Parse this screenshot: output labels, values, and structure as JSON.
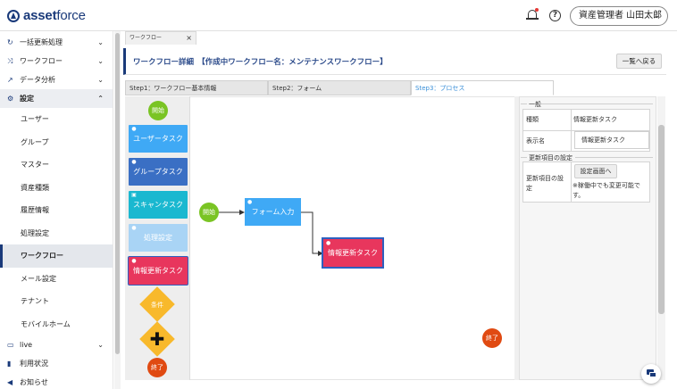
{
  "app": {
    "logo_text_bold": "asset",
    "logo_text_light": "force"
  },
  "header": {
    "user_label": "資産管理者 山田太郎",
    "icons": [
      "bell-icon",
      "help-icon"
    ]
  },
  "sidebar": {
    "items": [
      {
        "label": "一括更新処理",
        "icon": "refresh-icon",
        "chevron": "down"
      },
      {
        "label": "ワークフロー",
        "icon": "workflow-icon",
        "chevron": "down"
      },
      {
        "label": "データ分析",
        "icon": "chart-icon",
        "chevron": "down"
      },
      {
        "label": "設定",
        "icon": "gear-icon",
        "chevron": "up"
      }
    ],
    "sub_items": [
      {
        "label": "ユーザー"
      },
      {
        "label": "グループ"
      },
      {
        "label": "マスター"
      },
      {
        "label": "資産種類"
      },
      {
        "label": "履歴情報"
      },
      {
        "label": "処理設定"
      },
      {
        "label": "ワークフロー",
        "active": true
      },
      {
        "label": "メール設定"
      },
      {
        "label": "テナント"
      },
      {
        "label": "モバイルホーム"
      }
    ],
    "bottom_items": [
      {
        "label": "live",
        "icon": "live-icon",
        "chevron": "down"
      },
      {
        "label": "利用状況",
        "icon": "bar-chart-icon"
      },
      {
        "label": "お知らせ",
        "icon": "megaphone-icon"
      }
    ]
  },
  "main": {
    "tab_label": "ワークフロー",
    "title": "ワークフロー詳細　【作成中ワークフロー名：メンテナンスワークフロー】",
    "back_button": "一覧へ戻る",
    "steps": [
      {
        "label": "Step1：ワークフロー基本情報"
      },
      {
        "label": "Step2：フォーム"
      },
      {
        "label": "Step3：プロセス",
        "active": true
      }
    ]
  },
  "palette": {
    "start": "開始",
    "items": [
      {
        "label": "ユーザータスク",
        "color": "#3fa9f5",
        "icon": "user-icon"
      },
      {
        "label": "グループタスク",
        "color": "#3a6fc4",
        "icon": "group-icon"
      },
      {
        "label": "スキャンタスク",
        "color": "#1ab8d0",
        "icon": "scan-icon"
      },
      {
        "label": "処理設定",
        "color": "#a9d4f5",
        "icon": "process-icon"
      },
      {
        "label": "情報更新タスク",
        "color": "#e8365d",
        "icon": "update-icon"
      }
    ],
    "condition": "条件",
    "end": "終了",
    "accent_yellow": "#f8b92c"
  },
  "canvas": {
    "start": "開始",
    "nodes": [
      {
        "label": "フォーム入力",
        "color": "#3fa9f5"
      },
      {
        "label": "情報更新タスク",
        "color": "#e8365d"
      }
    ],
    "end": "終了"
  },
  "properties": {
    "general_section": "一般",
    "rows": [
      {
        "label": "種類",
        "value": "情報更新タスク"
      },
      {
        "label": "表示名",
        "value": "情報更新タスク"
      }
    ],
    "update_section": "更新項目の設定",
    "update_row_label": "更新項目の設定",
    "settings_button": "設定画面へ",
    "note": "※稼働中でも変更可能です。"
  }
}
